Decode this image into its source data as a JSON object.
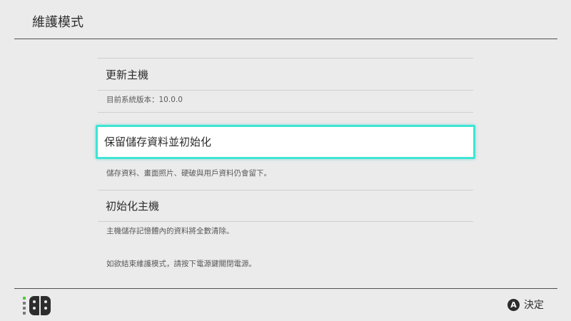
{
  "header": {
    "title": "維護模式"
  },
  "menu": {
    "update": {
      "label": "更新主機",
      "version_text": "目前系統版本：10.0.0"
    },
    "init_keep_save": {
      "label": "保留儲存資料並初始化",
      "description": "儲存資料、畫面照片、硬破與用戶資料仍會留下。"
    },
    "init_console": {
      "label": "初始化主機",
      "description": "主機儲存記憶體內的資料將全數清除。"
    },
    "exit_note": "如欲結束維護模式，請按下電源鍵關閉電源。"
  },
  "footer": {
    "controller_icon": "joycon-controller-icon",
    "a_button_glyph": "A",
    "confirm_label": "決定"
  },
  "colors": {
    "background": "#ebebeb",
    "selection_border": "#3ee5d4",
    "player_led": "#4fc936",
    "text": "#2d2d2d"
  }
}
